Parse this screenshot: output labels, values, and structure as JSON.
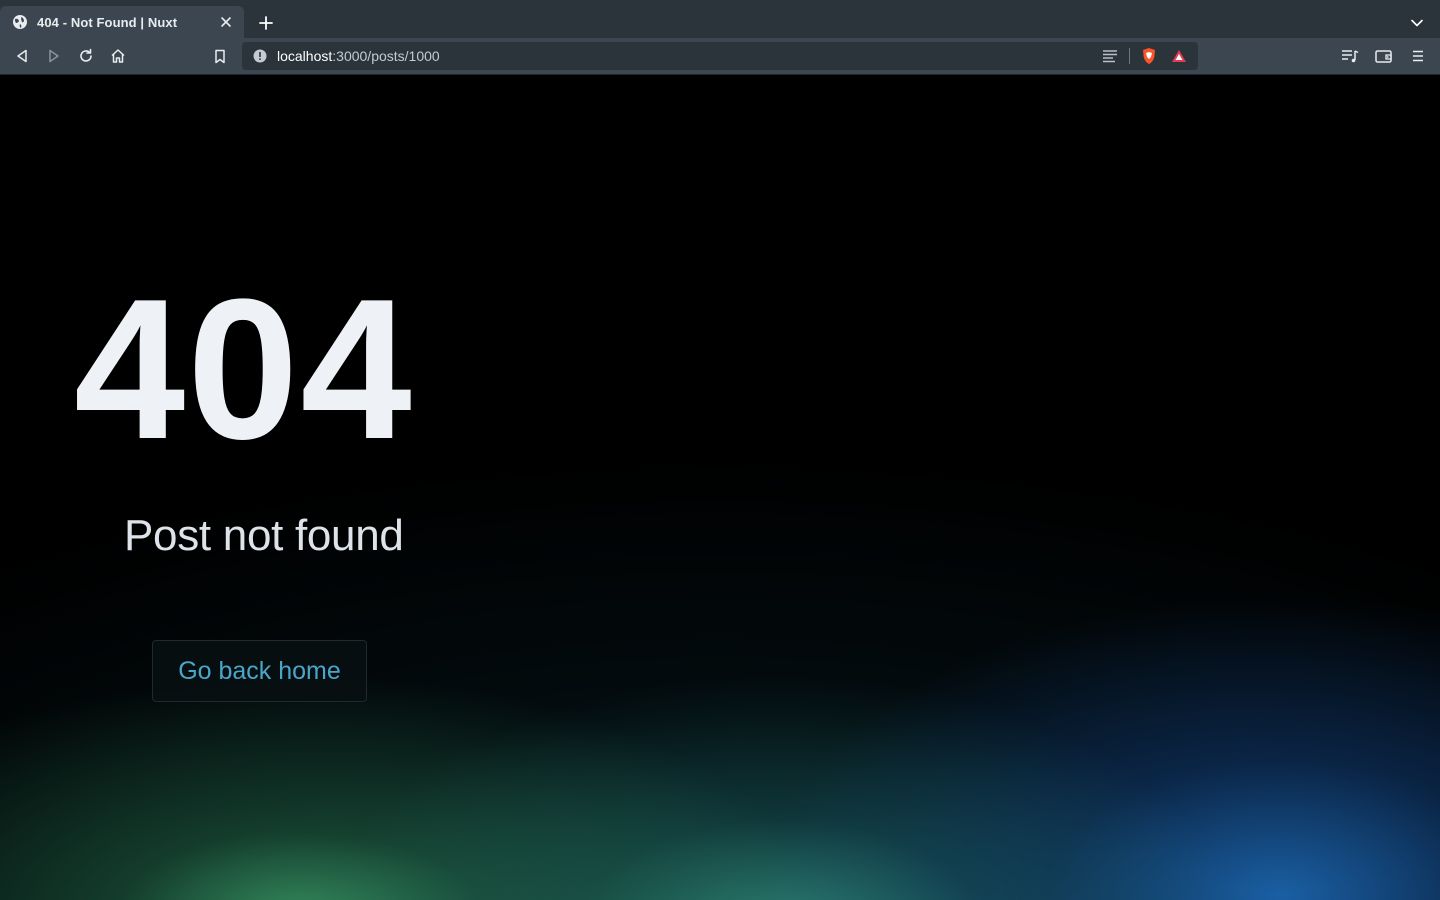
{
  "browser": {
    "tab": {
      "title": "404 - Not Found | Nuxt",
      "favicon": "globe-icon"
    },
    "tabstrip_icons": {
      "new_tab": "plus-icon",
      "tab_list": "chevron-down-icon"
    },
    "toolbar": {
      "back": "back-arrow-icon",
      "forward": "forward-arrow-icon",
      "reload": "reload-icon",
      "home": "home-icon",
      "bookmark": "bookmark-icon"
    },
    "address": {
      "host": "localhost",
      "path": ":3000/posts/1000"
    },
    "address_icons": [
      "reader-mode-icon",
      "brave-shields-icon",
      "brave-rewards-icon"
    ],
    "right_icons": [
      "playlist-icon",
      "wallet-icon",
      "menu-icon"
    ]
  },
  "page": {
    "status_code": "404",
    "message": "Post not found",
    "home_button": "Go back home"
  },
  "colors": {
    "chrome_dark": "#2b333b",
    "chrome_light": "#3c4650",
    "code_text": "#eef2f6",
    "link_blue": "#4aa6c9",
    "glow_green": "#40aa6e",
    "glow_teal": "#3caa96",
    "glow_blue": "#1e6ebe"
  }
}
